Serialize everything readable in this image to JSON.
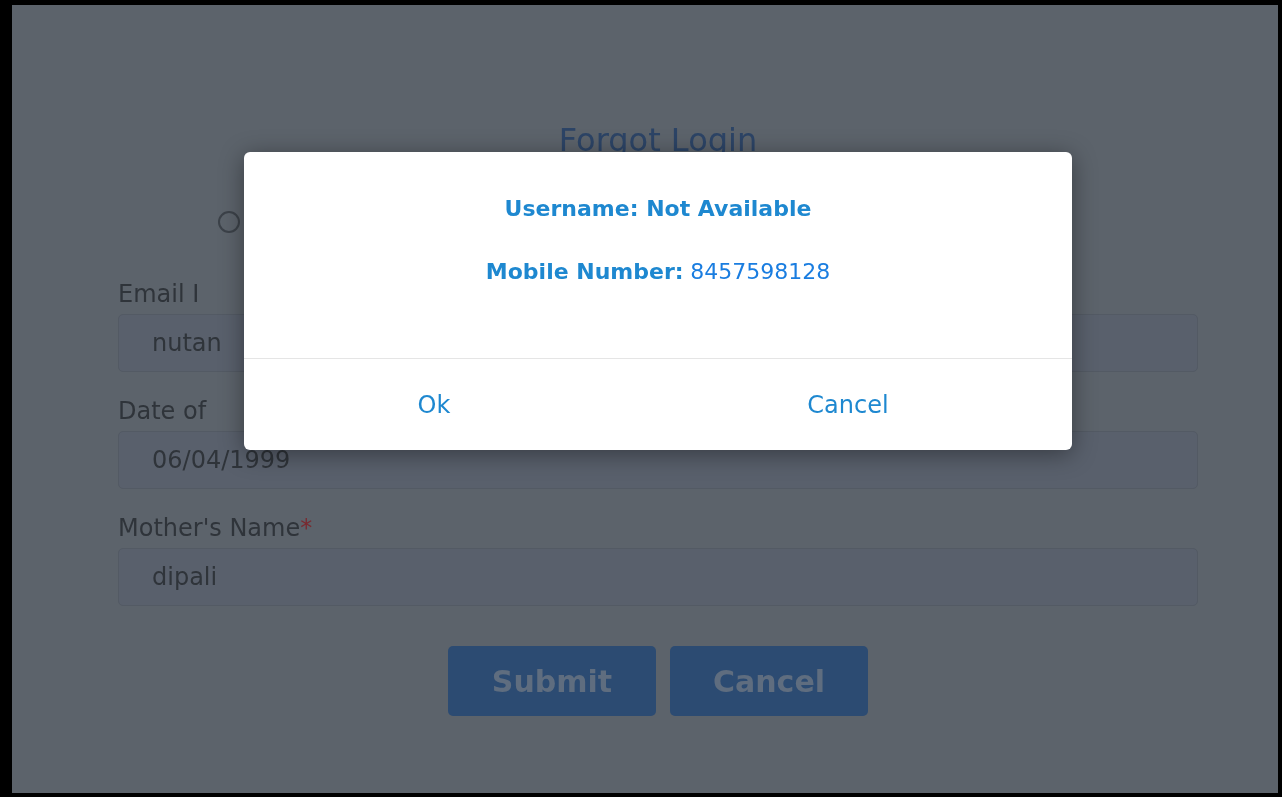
{
  "page": {
    "title": "Forgot Login",
    "radio": {
      "selected": false
    },
    "fields": [
      {
        "label": "Email I",
        "value": "nutan"
      },
      {
        "label": "Date of",
        "value": "06/04/1999"
      },
      {
        "label": "Mother's Name",
        "required_mark": "*",
        "value": "dipali"
      }
    ],
    "buttons": [
      "Submit",
      "Cancel"
    ]
  },
  "dialog": {
    "lines": [
      {
        "label": "Username: Not Available"
      },
      {
        "label": "Mobile Number:",
        "value": "8457598128"
      }
    ],
    "buttons": [
      "Ok",
      "Cancel"
    ]
  }
}
